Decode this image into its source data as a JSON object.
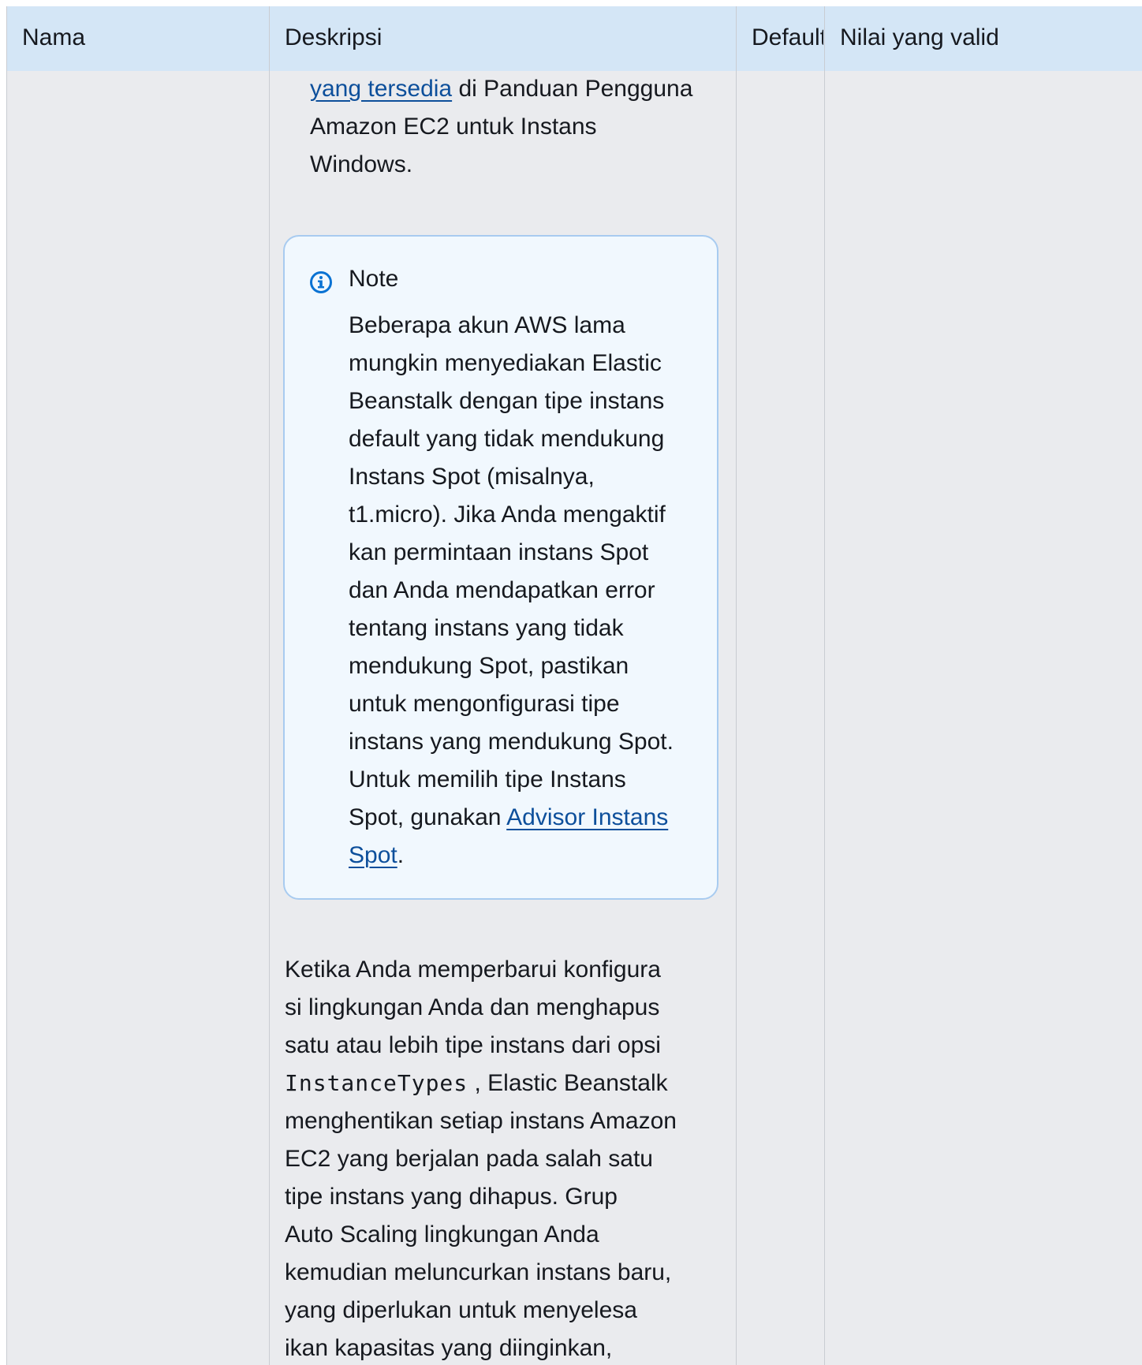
{
  "table": {
    "columns": [
      "Nama",
      "Deskripsi",
      "Default",
      "Nilai yang valid"
    ]
  },
  "top_paragraph": {
    "link_text": "yang tersedia",
    "line1_rest": " di Panduan Pengguna",
    "line2": "Amazon EC2 untuk Instans",
    "line3": "Windows."
  },
  "note": {
    "icon": "info-icon",
    "title": "Note",
    "lines": [
      "Beberapa akun AWS lama",
      "mungkin menyediakan Elastic",
      "Beanstalk dengan tipe instans",
      "default yang tidak mendukung",
      "Instans Spot (misalnya,",
      "t1.micro). Jika Anda mengaktif",
      "kan permintaan instans Spot",
      "dan Anda mendapatkan error",
      "tentang instans yang tidak",
      "mendukung Spot, pastikan",
      "untuk mengonfigurasi tipe",
      "instans yang mendukung Spot.",
      "Untuk memilih tipe Instans"
    ],
    "line14_text": "Spot, gunakan ",
    "link_part1": "Advisor Instans",
    "link_part2": "Spot",
    "line15_after": "."
  },
  "bottom_paragraph": {
    "lines_before_code": [
      "Ketika Anda memperbarui konfigura",
      "si lingkungan Anda dan menghapus",
      "satu atau lebih tipe instans dari opsi"
    ],
    "code_text": "InstanceTypes",
    "after_code": " , Elastic Beanstalk",
    "lines_after_code": [
      "menghentikan setiap instans Amazon",
      "EC2 yang berjalan pada salah satu",
      "tipe instans yang dihapus. Grup",
      "Auto Scaling lingkungan Anda",
      "kemudian meluncurkan instans baru,",
      "yang diperlukan untuk menyelesa",
      "ikan kapasitas yang diinginkan,"
    ]
  },
  "colors": {
    "header_bg": "#d4e6f6",
    "body_bg": "#eaebee",
    "link": "#0d4f9b",
    "note_bg": "#f1f8fe",
    "note_border": "#a8cbf0",
    "info_icon": "#0972d3"
  }
}
